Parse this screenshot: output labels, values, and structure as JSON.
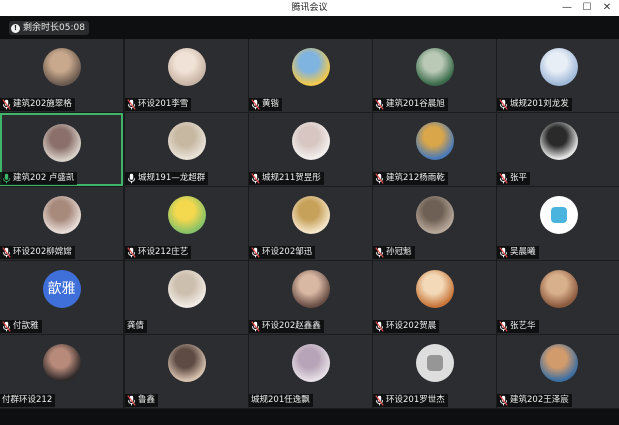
{
  "window": {
    "title": "腾讯会议",
    "min": "—",
    "max": "☐",
    "close": "✕"
  },
  "timer": {
    "icon": "info-icon",
    "text": "剩余时长05:08"
  },
  "colors": {
    "active_border": "#3fb56a",
    "mic_muted": "#e04848",
    "mic_on": "#3fb56a"
  },
  "participants": [
    {
      "name": "建筑202施翠格",
      "mic": "muted",
      "avatar": "photo"
    },
    {
      "name": "环设201李雪",
      "mic": "muted",
      "avatar": "photo"
    },
    {
      "name": "黄锴",
      "mic": "muted",
      "avatar": "cartoon"
    },
    {
      "name": "建筑201谷晨旭",
      "mic": "muted",
      "avatar": "photo"
    },
    {
      "name": "城规201刘龙发",
      "mic": "muted",
      "avatar": "photo"
    },
    {
      "name": "建筑202  卢盛凯",
      "mic": "on",
      "avatar": "illustration",
      "active": true
    },
    {
      "name": "城规191—龙超群",
      "mic": "on-white",
      "avatar": "photo"
    },
    {
      "name": "城规211贺昱彤",
      "mic": "muted",
      "avatar": "photo"
    },
    {
      "name": "建筑212杨雨乾",
      "mic": "muted",
      "avatar": "photo"
    },
    {
      "name": "张平",
      "mic": "muted",
      "avatar": "photo"
    },
    {
      "name": "环设202柳嫦嫦",
      "mic": "muted",
      "avatar": "illustration"
    },
    {
      "name": "环设212庄艺",
      "mic": "muted",
      "avatar": "cartoon"
    },
    {
      "name": "环设202邹迅",
      "mic": "muted",
      "avatar": "cartoon"
    },
    {
      "name": "孙冠魁",
      "mic": "muted",
      "avatar": "photo"
    },
    {
      "name": "吴晨曦",
      "mic": "muted",
      "avatar": "logo"
    },
    {
      "name": "付歆雅",
      "mic": "muted",
      "avatar": "text",
      "avatar_text": "歆雅"
    },
    {
      "name": "龚倩",
      "mic": "none",
      "avatar": "photo"
    },
    {
      "name": "环设202赵鑫鑫",
      "mic": "muted",
      "avatar": "photo"
    },
    {
      "name": "环设202贺晨",
      "mic": "muted",
      "avatar": "photo"
    },
    {
      "name": "张艺华",
      "mic": "muted",
      "avatar": "photo"
    },
    {
      "name": "付群环设212",
      "mic": "none",
      "avatar": "photo"
    },
    {
      "name": "鲁鑫",
      "mic": "muted",
      "avatar": "photo"
    },
    {
      "name": "城规201任逸飘",
      "mic": "none",
      "avatar": "photo"
    },
    {
      "name": "环设201罗世杰",
      "mic": "muted",
      "avatar": "logo"
    },
    {
      "name": "建筑202王泽宸",
      "mic": "muted",
      "avatar": "photo"
    }
  ]
}
